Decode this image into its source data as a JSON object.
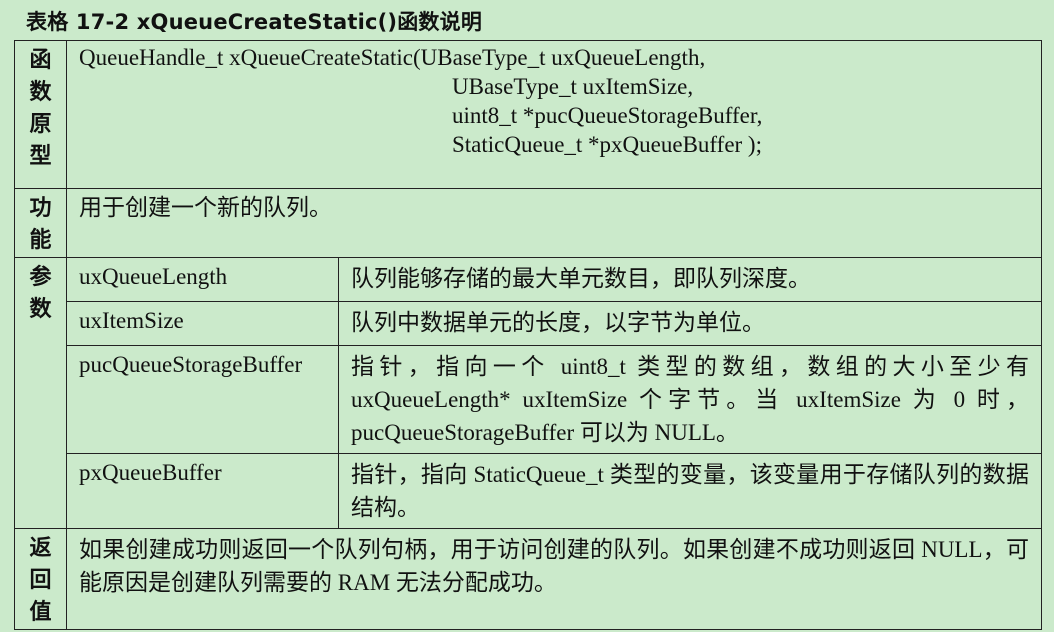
{
  "caption": "表格 17-2 xQueueCreateStatic()函数说明",
  "prototype": {
    "label": "函数原型",
    "lines": [
      "QueueHandle_t xQueueCreateStatic(UBaseType_t uxQueueLength,",
      "UBaseType_t uxItemSize,",
      "uint8_t *pucQueueStorageBuffer,",
      "StaticQueue_t *pxQueueBuffer );"
    ]
  },
  "function": {
    "label": "功能",
    "text": "用于创建一个新的队列。"
  },
  "params": {
    "label": "参数",
    "rows": [
      {
        "name": "uxQueueLength",
        "desc": "队列能够存储的最大单元数目，即队列深度。"
      },
      {
        "name": "uxItemSize",
        "desc": "队列中数据单元的长度，以字节为单位。"
      },
      {
        "name": "pucQueueStorageBuffer",
        "desc": "指针，指向一个 uint8_t 类型的数组，数组的大小至少有 uxQueueLength* uxItemSize 个字节。当 uxItemSize 为 0 时，pucQueueStorageBuffer 可以为 NULL。"
      },
      {
        "name": "pxQueueBuffer",
        "desc": "指针，指向 StaticQueue_t 类型的变量，该变量用于存储队列的数据结构。"
      }
    ]
  },
  "return": {
    "label": "返回值",
    "text": "如果创建成功则返回一个队列句柄，用于访问创建的队列。如果创建不成功则返回 NULL，可能原因是创建队列需要的 RAM 无法分配成功。"
  }
}
